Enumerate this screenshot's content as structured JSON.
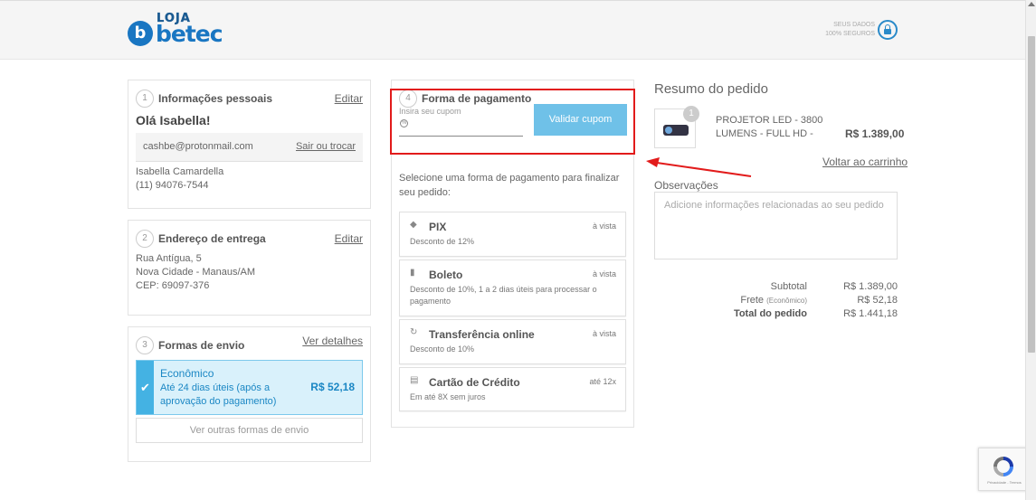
{
  "header": {
    "logo_top": "LOJA",
    "logo_main": "betec",
    "logo_letter": "b",
    "secure_line1": "SEUS DADOS",
    "secure_line2": "100% SEGUROS"
  },
  "personal": {
    "step": "1",
    "title": "Informações pessoais",
    "edit": "Editar",
    "greeting": "Olá Isabella!",
    "email": "cashbe@protonmail.com",
    "swap": "Sair ou trocar",
    "name": "Isabella Camardella",
    "phone": "(11) 94076-7544"
  },
  "address": {
    "step": "2",
    "title": "Endereço de entrega",
    "edit": "Editar",
    "line1": "Rua Antígua, 5",
    "line2": "Nova Cidade - Manaus/AM",
    "line3": "CEP: 69097-376"
  },
  "shipping": {
    "step": "3",
    "title": "Formas de envio",
    "details": "Ver detalhes",
    "option_name": "Econômico",
    "option_desc": "Até 24 dias úteis (após a aprovação do pagamento)",
    "option_price": "R$ 52,18",
    "other": "Ver outras formas de envio"
  },
  "payment": {
    "step": "4",
    "title": "Forma de pagamento",
    "coupon_label": "Insira seu cupom",
    "coupon_value": "",
    "coupon_button": "Validar cupom",
    "intro": "Selecione uma forma de pagamento para finalizar seu pedido:",
    "options": [
      {
        "name": "PIX",
        "badge": "à vista",
        "desc": "Desconto de 12%",
        "icon": "pix-icon"
      },
      {
        "name": "Boleto",
        "badge": "à vista",
        "desc": "Desconto de 10%, 1 a 2 dias úteis para processar o pagamento",
        "icon": "barcode-icon"
      },
      {
        "name": "Transferência online",
        "badge": "à vista",
        "desc": "Desconto de 10%",
        "icon": "transfer-icon"
      },
      {
        "name": "Cartão de Crédito",
        "badge": "até 12x",
        "desc": "Em até 8X sem juros",
        "icon": "credit-card-icon"
      }
    ]
  },
  "summary": {
    "title": "Resumo do pedido",
    "qty": "1",
    "product": "PROJETOR LED - 3800 LUMENS - FULL HD -",
    "price": "R$ 1.389,00",
    "back": "Voltar ao carrinho",
    "obs_label": "Observações",
    "obs_placeholder": "Adicione informações relacionadas ao seu pedido",
    "subtotal_label": "Subtotal",
    "subtotal": "R$ 1.389,00",
    "freight_label": "Frete",
    "freight_note": "(Econômico)",
    "freight": "R$ 52,18",
    "total_label": "Total do pedido",
    "total": "R$ 1.441,18"
  },
  "recaptcha": {
    "text": "Privacidade - Termos"
  },
  "colors": {
    "accent": "#1976c2",
    "highlight": "#e21b1b",
    "selected": "#d9f1fb",
    "button": "#6fc1e8"
  }
}
